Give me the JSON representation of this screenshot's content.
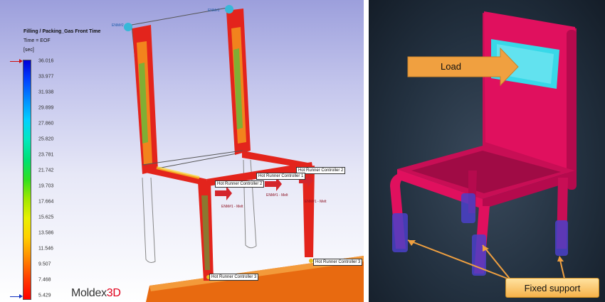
{
  "left_panel": {
    "title": "Filling / Packing_Gas Front Time",
    "time": "Time = EOF",
    "unit": "[sec]",
    "ticks": [
      "36.016",
      "33.977",
      "31.938",
      "29.899",
      "27.860",
      "25.820",
      "23.781",
      "21.742",
      "19.703",
      "17.664",
      "15.625",
      "13.586",
      "11.546",
      "9.507",
      "7.468",
      "5.429"
    ],
    "brand_left": "Moldex",
    "brand_right": "3D",
    "callouts": {
      "hrc2_top": "Hot Runner Controller 2",
      "hrc1": "Hot Runner Controller 1",
      "hrc2_mid": "Hot Runner Controller 2",
      "hrc3_right": "Hot Runner Controller 3",
      "hrc3_bottom": "Hot Runner Controller 3"
    },
    "melts": [
      "ENM#1 - Melt",
      "ENM#1 - Melt",
      "ENM#1 - Melt"
    ],
    "small_labels": [
      "ENM#2",
      "ENM#2"
    ],
    "marker_colors": {
      "top": "#d01010",
      "bottom": "#1030c0"
    }
  },
  "right_panel": {
    "load_label": "Load",
    "support_label": "Fixed support",
    "colors": {
      "chair": "#e0105e",
      "load_area": "#38d8e8",
      "support": "#4a3fc8",
      "arrow": "#f0a040"
    }
  }
}
